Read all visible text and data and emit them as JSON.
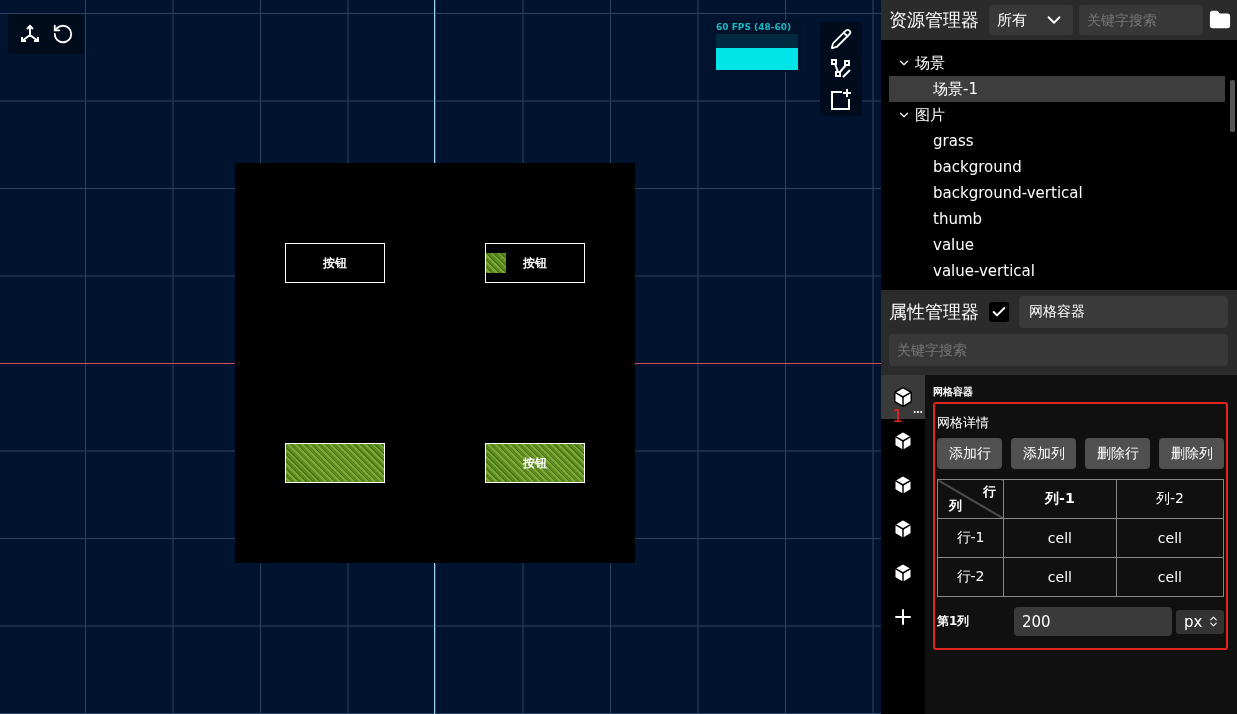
{
  "canvas": {
    "fps_label": "60 FPS (48-60)",
    "widgets": [
      {
        "kind": "outline",
        "label": "按钮",
        "icon": false
      },
      {
        "kind": "outline",
        "label": "按钮",
        "icon": true
      },
      {
        "kind": "texture",
        "icon": false
      },
      {
        "kind": "texture",
        "label": "按钮",
        "icon": false
      }
    ]
  },
  "resource_manager": {
    "title": "资源管理器",
    "filter": "所有",
    "search_placeholder": "关键字搜索",
    "tree": [
      {
        "label": "场景",
        "expanded": true,
        "selected": false,
        "children": [
          {
            "label": "场景-1",
            "selected": true
          }
        ]
      },
      {
        "label": "图片",
        "expanded": true,
        "selected": false,
        "children": [
          {
            "label": "grass",
            "selected": false
          },
          {
            "label": "background",
            "selected": false
          },
          {
            "label": "background-vertical",
            "selected": false
          },
          {
            "label": "thumb",
            "selected": false
          },
          {
            "label": "value",
            "selected": false
          },
          {
            "label": "value-vertical",
            "selected": false
          }
        ]
      }
    ]
  },
  "property_manager": {
    "title": "属性管理器",
    "enabled": true,
    "name": "网格容器",
    "search_placeholder": "关键字搜索",
    "components": [
      {
        "selected": true
      },
      {
        "selected": false
      },
      {
        "selected": false
      },
      {
        "selected": false
      },
      {
        "selected": false
      }
    ],
    "section_title": "网格容器",
    "annotation": "1",
    "grid_details": {
      "title": "网格详情",
      "buttons": [
        "添加行",
        "添加列",
        "删除行",
        "删除列"
      ],
      "corner_row": "行",
      "corner_column": "列",
      "columns": [
        {
          "label": "列-1",
          "selected": true
        },
        {
          "label": "列-2",
          "selected": false
        }
      ],
      "rows": [
        {
          "label": "行-1",
          "cells": [
            "cell",
            "cell"
          ]
        },
        {
          "label": "行-2",
          "cells": [
            "cell",
            "cell"
          ]
        }
      ]
    },
    "column_setting": {
      "label": "第1列",
      "value": "200",
      "unit": "px"
    }
  }
}
